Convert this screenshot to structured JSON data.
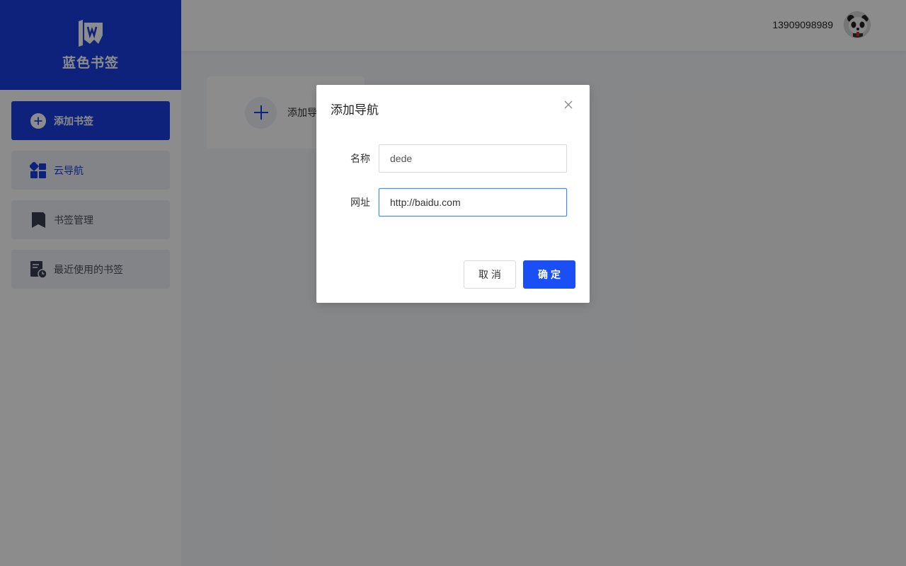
{
  "brand": {
    "name": "蓝色书签"
  },
  "sidebar": {
    "items": [
      {
        "label": "添加书签",
        "icon": "plus-circle-icon"
      },
      {
        "label": "云导航",
        "icon": "grid-apps-icon"
      },
      {
        "label": "书签管理",
        "icon": "bookmark-icon"
      },
      {
        "label": "最近使用的书签",
        "icon": "recent-doc-clock-icon"
      }
    ]
  },
  "header": {
    "phone": "13909098989",
    "avatar_icon": "panda-avatar-icon"
  },
  "main": {
    "add_card_label": "添加导航"
  },
  "dialog": {
    "title": "添加导航",
    "name_label": "名称",
    "name_value": "dede",
    "url_label": "网址",
    "url_value": "http://baidu.com",
    "cancel_label": "取消",
    "ok_label": "确定"
  },
  "colors": {
    "primary": "#1a3fe0",
    "button_primary": "#1a4ff5",
    "focus_border": "#3d87ff"
  }
}
